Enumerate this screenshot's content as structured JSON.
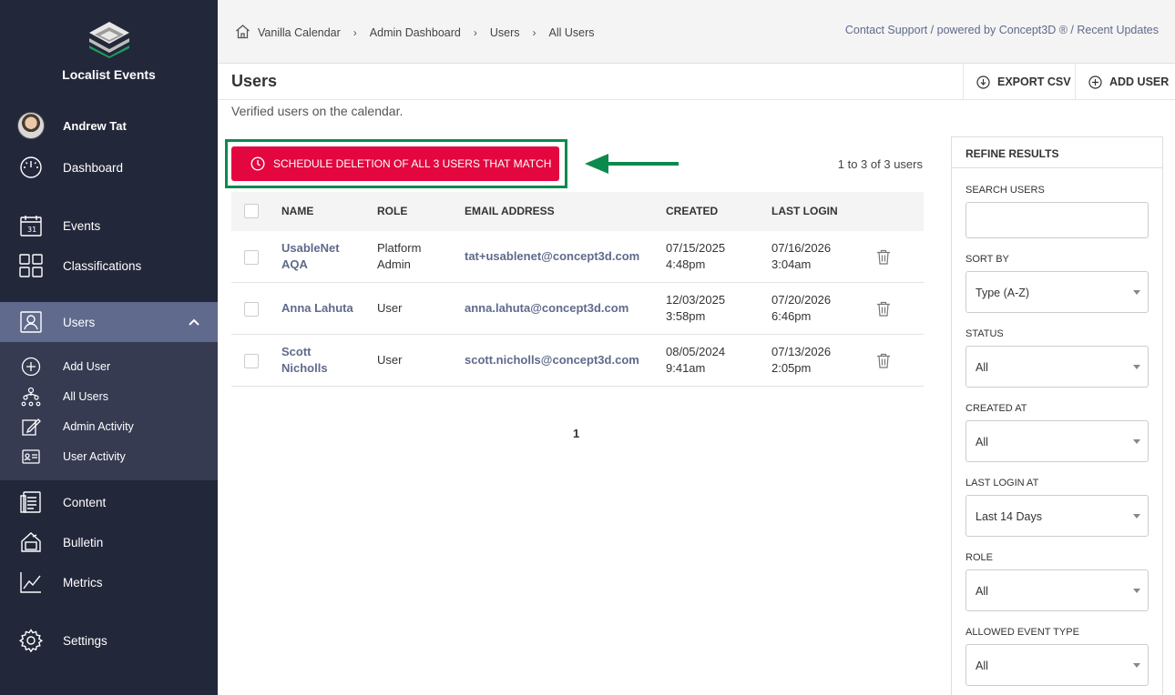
{
  "sidebar": {
    "brand": "Localist Events",
    "user_name": "Andrew Tat",
    "items": [
      {
        "label": "Dashboard",
        "icon": "gauge-icon"
      },
      {
        "label": "Events",
        "icon": "calendar-icon"
      },
      {
        "label": "Classifications",
        "icon": "grid-icon"
      },
      {
        "label": "Users",
        "icon": "user-icon"
      },
      {
        "label": "Content",
        "icon": "document-icon"
      },
      {
        "label": "Bulletin",
        "icon": "bulletin-icon"
      },
      {
        "label": "Metrics",
        "icon": "chart-icon"
      },
      {
        "label": "Settings",
        "icon": "gear-icon"
      }
    ],
    "subitems": [
      {
        "label": "Add User",
        "icon": "plus-circle-icon"
      },
      {
        "label": "All Users",
        "icon": "org-chart-icon"
      },
      {
        "label": "Admin Activity",
        "icon": "edit-icon"
      },
      {
        "label": "User Activity",
        "icon": "id-card-icon"
      }
    ],
    "active_color": "#5f6a8c",
    "bg_color": "#23273a"
  },
  "breadcrumb": [
    "Vanilla Calendar",
    "Admin Dashboard",
    "Users",
    "All Users"
  ],
  "toplinks": "Contact Support / powered by Concept3D ® / Recent Updates",
  "header": {
    "title": "Users",
    "export_label": "EXPORT CSV",
    "add_label": "ADD USER"
  },
  "subtitle": "Verified users on the calendar.",
  "schedule_button": "SCHEDULE DELETION OF ALL 3 USERS THAT MATCH",
  "count_text": "1 to 3 of 3 users",
  "table": {
    "headers": [
      "NAME",
      "ROLE",
      "EMAIL ADDRESS",
      "CREATED",
      "LAST LOGIN"
    ],
    "rows": [
      {
        "name1": "UsableNet",
        "name2": "AQA",
        "role1": "Platform",
        "role2": "Admin",
        "email": "tat+usablenet@concept3d.com",
        "created1": "07/15/2025",
        "created2": "4:48pm",
        "login1": "07/16/2026",
        "login2": "3:04am"
      },
      {
        "name1": "Anna Lahuta",
        "name2": "",
        "role1": "User",
        "role2": "",
        "email": "anna.lahuta@concept3d.com",
        "created1": "12/03/2025",
        "created2": "3:58pm",
        "login1": "07/20/2026",
        "login2": "6:46pm"
      },
      {
        "name1": "Scott",
        "name2": "Nicholls",
        "role1": "User",
        "role2": "",
        "email": "scott.nicholls@concept3d.com",
        "created1": "08/05/2024",
        "created2": "9:41am",
        "login1": "07/13/2026",
        "login2": "2:05pm"
      }
    ]
  },
  "pager": "1",
  "refine": {
    "title": "REFINE RESULTS",
    "search_label": "SEARCH USERS",
    "search_value": "",
    "filters": [
      {
        "label": "SORT BY",
        "value": "Type (A-Z)"
      },
      {
        "label": "STATUS",
        "value": "All"
      },
      {
        "label": "CREATED AT",
        "value": "All"
      },
      {
        "label": "LAST LOGIN AT",
        "value": "Last 14 Days"
      },
      {
        "label": "ROLE",
        "value": "All"
      },
      {
        "label": "ALLOWED EVENT TYPE",
        "value": "All"
      }
    ]
  },
  "colors": {
    "danger": "#e3063f",
    "highlight": "#0b8a4e",
    "link": "#5f6a8c"
  }
}
